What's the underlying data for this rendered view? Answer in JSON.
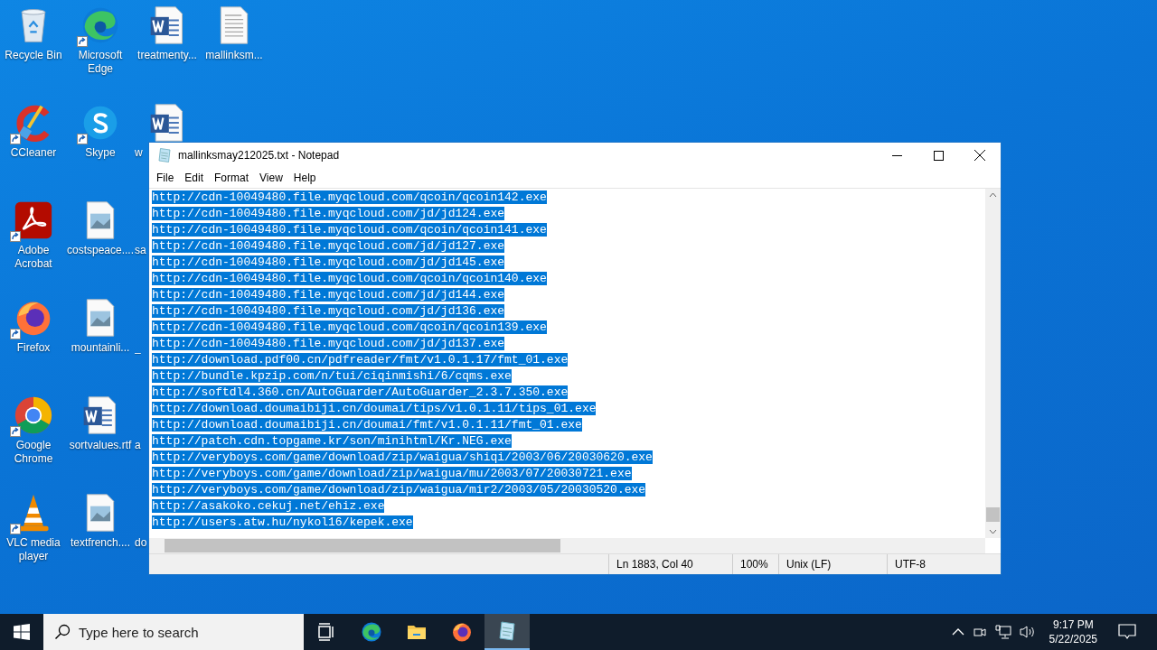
{
  "desktop": {
    "icons": [
      {
        "label": "Recycle Bin",
        "kind": "recycle",
        "shortcut": false,
        "partial": false
      },
      {
        "label": "CCleaner",
        "kind": "ccleaner",
        "shortcut": true,
        "partial": false
      },
      {
        "label": "Adobe Acrobat",
        "kind": "acrobat",
        "shortcut": true,
        "partial": false
      },
      {
        "label": "Firefox",
        "kind": "firefox",
        "shortcut": true,
        "partial": false
      },
      {
        "label": "Google Chrome",
        "kind": "chrome",
        "shortcut": true,
        "partial": false
      },
      {
        "label": "VLC media player",
        "kind": "vlc",
        "shortcut": true,
        "partial": false
      },
      {
        "label": "Microsoft Edge",
        "kind": "edge",
        "shortcut": true,
        "partial": false
      },
      {
        "label": "Skype",
        "kind": "skype",
        "shortcut": true,
        "partial": false
      },
      {
        "label": "costspeace....",
        "kind": "image",
        "shortcut": false,
        "partial": false
      },
      {
        "label": "mountainli...",
        "kind": "image",
        "shortcut": false,
        "partial": false
      },
      {
        "label": "sortvalues.rtf",
        "kind": "word",
        "shortcut": false,
        "partial": false
      },
      {
        "label": "textfrench....",
        "kind": "image",
        "shortcut": false,
        "partial": false
      },
      {
        "label": "treatmenty...",
        "kind": "word",
        "shortcut": false,
        "partial": false
      },
      {
        "label": "w",
        "kind": "word",
        "shortcut": false,
        "partial": true
      },
      {
        "label": "sa",
        "kind": "none",
        "partial": true
      },
      {
        "label": "_",
        "kind": "none",
        "partial": true
      },
      {
        "label": "a",
        "kind": "none",
        "partial": true
      },
      {
        "label": "do",
        "kind": "none",
        "partial": true
      },
      {
        "label": "mallinksm...",
        "kind": "text",
        "shortcut": false,
        "partial": false
      }
    ]
  },
  "window": {
    "title": "mallinksmay212025.txt - Notepad",
    "menu": [
      "File",
      "Edit",
      "Format",
      "View",
      "Help"
    ],
    "lines": [
      {
        "text": "http://cdn-10049480.file.myqcloud.com/qcoin/qcoin142.exe",
        "selected": true
      },
      {
        "text": "http://cdn-10049480.file.myqcloud.com/jd/jd124.exe",
        "selected": true
      },
      {
        "text": "http://cdn-10049480.file.myqcloud.com/qcoin/qcoin141.exe",
        "selected": true
      },
      {
        "text": "http://cdn-10049480.file.myqcloud.com/jd/jd127.exe",
        "selected": true
      },
      {
        "text": "http://cdn-10049480.file.myqcloud.com/jd/jd145.exe",
        "selected": true
      },
      {
        "text": "http://cdn-10049480.file.myqcloud.com/qcoin/qcoin140.exe",
        "selected": true
      },
      {
        "text": "http://cdn-10049480.file.myqcloud.com/jd/jd144.exe",
        "selected": true
      },
      {
        "text": "http://cdn-10049480.file.myqcloud.com/jd/jd136.exe",
        "selected": true
      },
      {
        "text": "http://cdn-10049480.file.myqcloud.com/qcoin/qcoin139.exe",
        "selected": true
      },
      {
        "text": "http://cdn-10049480.file.myqcloud.com/jd/jd137.exe",
        "selected": true
      },
      {
        "text": "http://download.pdf00.cn/pdfreader/fmt/v1.0.1.17/fmt_01.exe",
        "selected": true
      },
      {
        "text": "http://bundle.kpzip.com/n/tui/ciqinmishi/6/cqms.exe",
        "selected": true
      },
      {
        "text": "http://softdl4.360.cn/AutoGuarder/AutoGuarder_2.3.7.350.exe",
        "selected": true
      },
      {
        "text": "http://download.doumaibiji.cn/doumai/tips/v1.0.1.11/tips_01.exe",
        "selected": true
      },
      {
        "text": "http://download.doumaibiji.cn/doumai/fmt/v1.0.1.11/fmt_01.exe",
        "selected": true
      },
      {
        "text": "http://patch.cdn.topgame.kr/son/minihtml/Kr.NEG.exe",
        "selected": true
      },
      {
        "text": "http://veryboys.com/game/download/zip/waigua/shiqi/2003/06/20030620.exe",
        "selected": true
      },
      {
        "text": "http://veryboys.com/game/download/zip/waigua/mu/2003/07/20030721.exe",
        "selected": true
      },
      {
        "text": "http://veryboys.com/game/download/zip/waigua/mir2/2003/05/20030520.exe",
        "selected": true
      },
      {
        "text": "http://asakoko.cekuj.net/ehiz.exe",
        "selected": true
      },
      {
        "text": "http://users.atw.hu/nykol16/kepek.exe",
        "selected": true
      }
    ],
    "status": [
      "Ln 1883, Col 40",
      "100%",
      "Unix (LF)",
      "UTF-8"
    ]
  },
  "taskbar": {
    "search": {
      "placeholder": "Type here to search"
    },
    "apps": [
      {
        "kind": "taskview",
        "active": false
      },
      {
        "kind": "edge",
        "active": false
      },
      {
        "kind": "folder",
        "active": false
      },
      {
        "kind": "firefox",
        "active": false
      },
      {
        "kind": "notepad",
        "active": true
      }
    ],
    "time": "9:17 PM",
    "date": "5/22/2025"
  }
}
